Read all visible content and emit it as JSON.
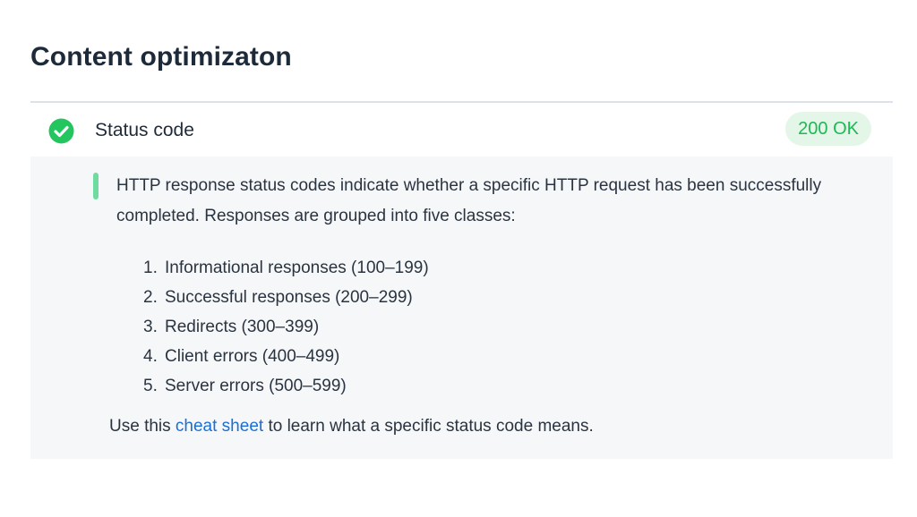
{
  "section": {
    "title": "Content optimizaton"
  },
  "check": {
    "label": "Status code",
    "status_badge": "200 OK",
    "status_icon": "check-circle-icon",
    "colors": {
      "success": "#22c55e",
      "badge_bg": "#e3f6e8",
      "badge_text": "#1db954",
      "accent": "#6fdba0",
      "link": "#1a6fd6"
    }
  },
  "details": {
    "description": "HTTP response status codes indicate whether a specific HTTP request has been successfully completed. Responses are grouped into five classes:",
    "classes": [
      {
        "num": "1.",
        "text": "Informational responses (100–199)"
      },
      {
        "num": "2.",
        "text": "Successful responses (200–299)"
      },
      {
        "num": "3.",
        "text": "Redirects (300–399)"
      },
      {
        "num": "4.",
        "text": "Client errors (400–499)"
      },
      {
        "num": "5.",
        "text": "Server errors (500–599)"
      }
    ],
    "footer": {
      "before": "Use this ",
      "link": "cheat sheet",
      "after": " to learn what a specific status code means."
    }
  }
}
